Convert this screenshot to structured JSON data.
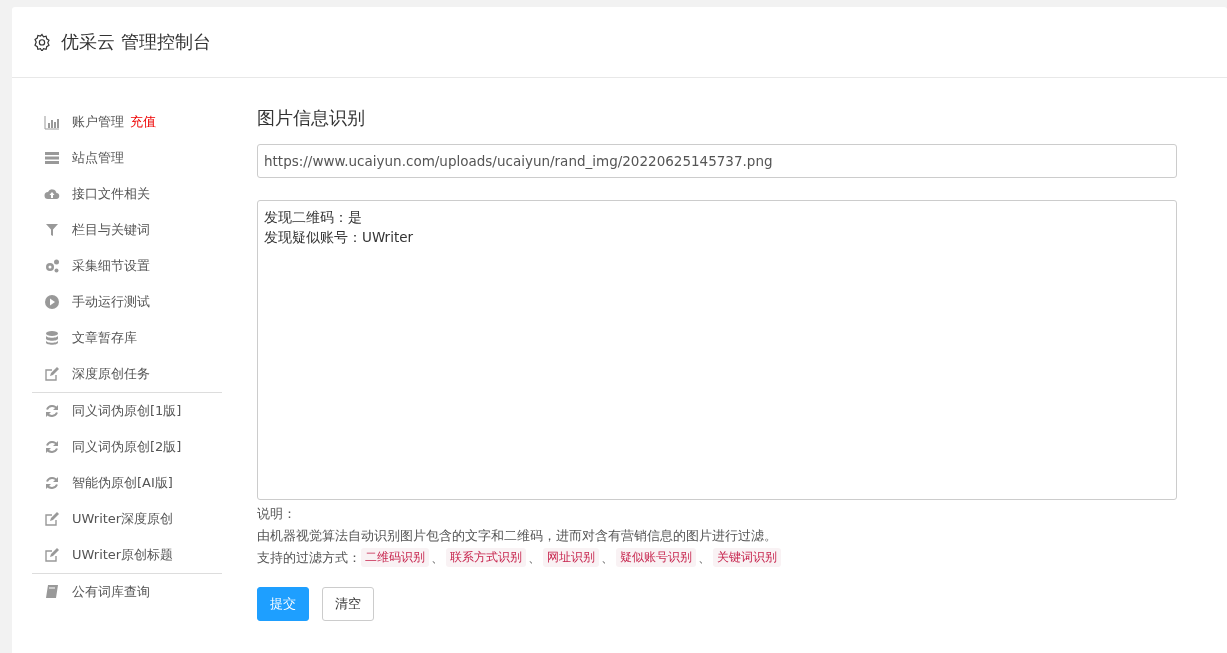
{
  "header": {
    "title": "优采云 管理控制台"
  },
  "sidebar": {
    "sections": [
      {
        "items": [
          {
            "label": "账户管理",
            "badge": "充值"
          },
          {
            "label": "站点管理"
          },
          {
            "label": "接口文件相关"
          },
          {
            "label": "栏目与关键词"
          },
          {
            "label": "采集细节设置"
          },
          {
            "label": "手动运行测试"
          },
          {
            "label": "文章暂存库"
          },
          {
            "label": "深度原创任务"
          }
        ]
      },
      {
        "items": [
          {
            "label": "同义词伪原创[1版]"
          },
          {
            "label": "同义词伪原创[2版]"
          },
          {
            "label": "智能伪原创[AI版]"
          },
          {
            "label": "UWriter深度原创"
          },
          {
            "label": "UWriter原创标题"
          }
        ]
      },
      {
        "items": [
          {
            "label": "公有词库查询"
          }
        ]
      }
    ]
  },
  "main": {
    "heading": "图片信息识别",
    "url_field": {
      "value": "https://www.ucaiyun.com/uploads/ucaiyun/rand_img/20220625145737.png"
    },
    "result_lines": [
      "发现二维码：是",
      "发现疑似账号：UWriter"
    ],
    "note_label": "说明：",
    "note_text": "由机器视觉算法自动识别图片包含的文字和二维码，进而对含有营销信息的图片进行过滤。",
    "filters_label": "支持的过滤方式：",
    "filters": [
      "二维码识别",
      "联系方式识别",
      "网址识别",
      "疑似账号识别",
      "关键词识别"
    ],
    "separator": "、",
    "buttons": [
      {
        "label": "提交",
        "kind": "primary"
      },
      {
        "label": "清空",
        "kind": "default"
      }
    ]
  }
}
